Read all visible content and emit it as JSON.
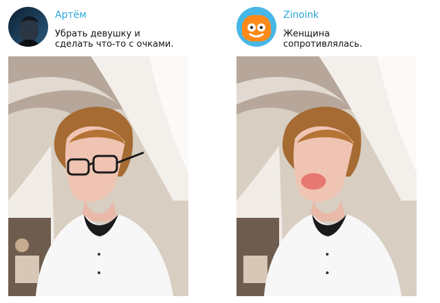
{
  "posts": [
    {
      "author": "Артём",
      "message": "Убрать девушку и\nсделать что-то с очками.",
      "avatar_icon": "user-photo-avatar",
      "photo_variant": "with-glasses"
    },
    {
      "author": "Zinoink",
      "message": "Женщина\nсопротивлялась.",
      "avatar_icon": "cartoon-avatar",
      "photo_variant": "no-glasses-red-cheek"
    }
  ],
  "colors": {
    "author": "#2aa7d8",
    "text": "#111111",
    "zinoink_avatar_bg": "#46b7e6",
    "zinoink_avatar_fg": "#ff8a1a"
  }
}
